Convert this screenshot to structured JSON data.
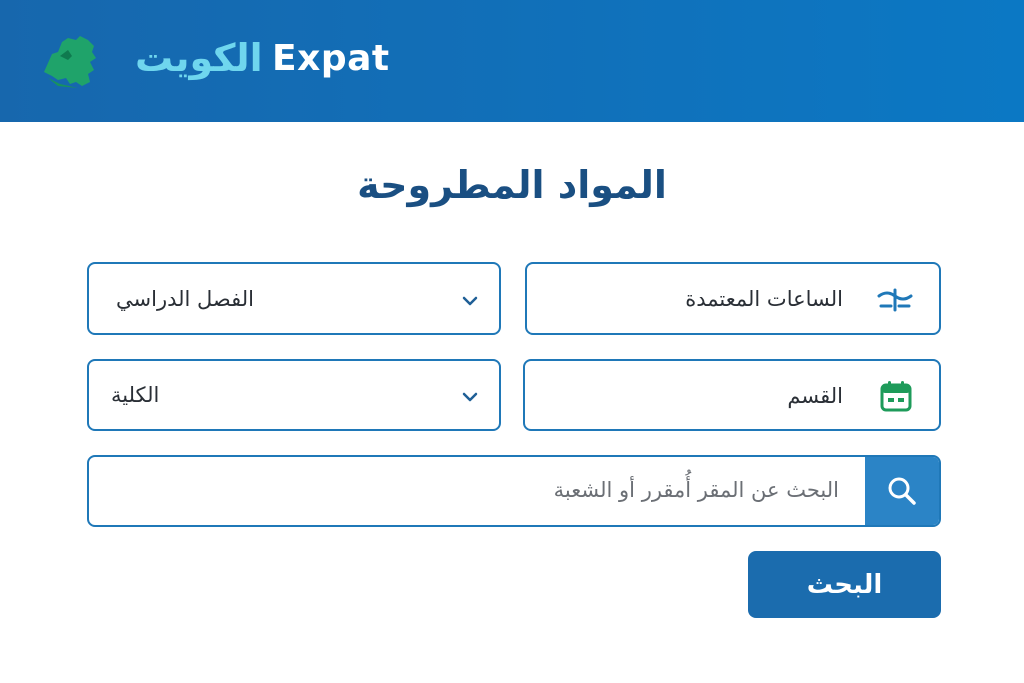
{
  "header": {
    "logo_ar": "الكويت",
    "logo_en": "Expat"
  },
  "page": {
    "title": "المواد المطروحة"
  },
  "filters": {
    "credit_hours": "الساعات المعتمدة",
    "semester": "الفصل الدراسي",
    "department": "القسم",
    "college": "الكلية"
  },
  "search": {
    "placeholder": "البحث عن المقر أُمقرر أو الشعبة"
  },
  "submit": {
    "label": "البحث"
  },
  "colors": {
    "header_start": "#1767ad",
    "header_end": "#0b78c4",
    "logo_green": "#1fa36a",
    "logo_cyan": "#6fd6ee",
    "field_border": "#1f78b8",
    "title": "#1a4f82",
    "calendar_green": "#1e9b5a",
    "button": "#1b6cae"
  },
  "icons": {
    "logo": "kuwait-map-icon",
    "credit_hours": "scale-icon",
    "department": "calendar-icon",
    "dropdown": "chevron-down-icon",
    "search": "search-icon"
  }
}
